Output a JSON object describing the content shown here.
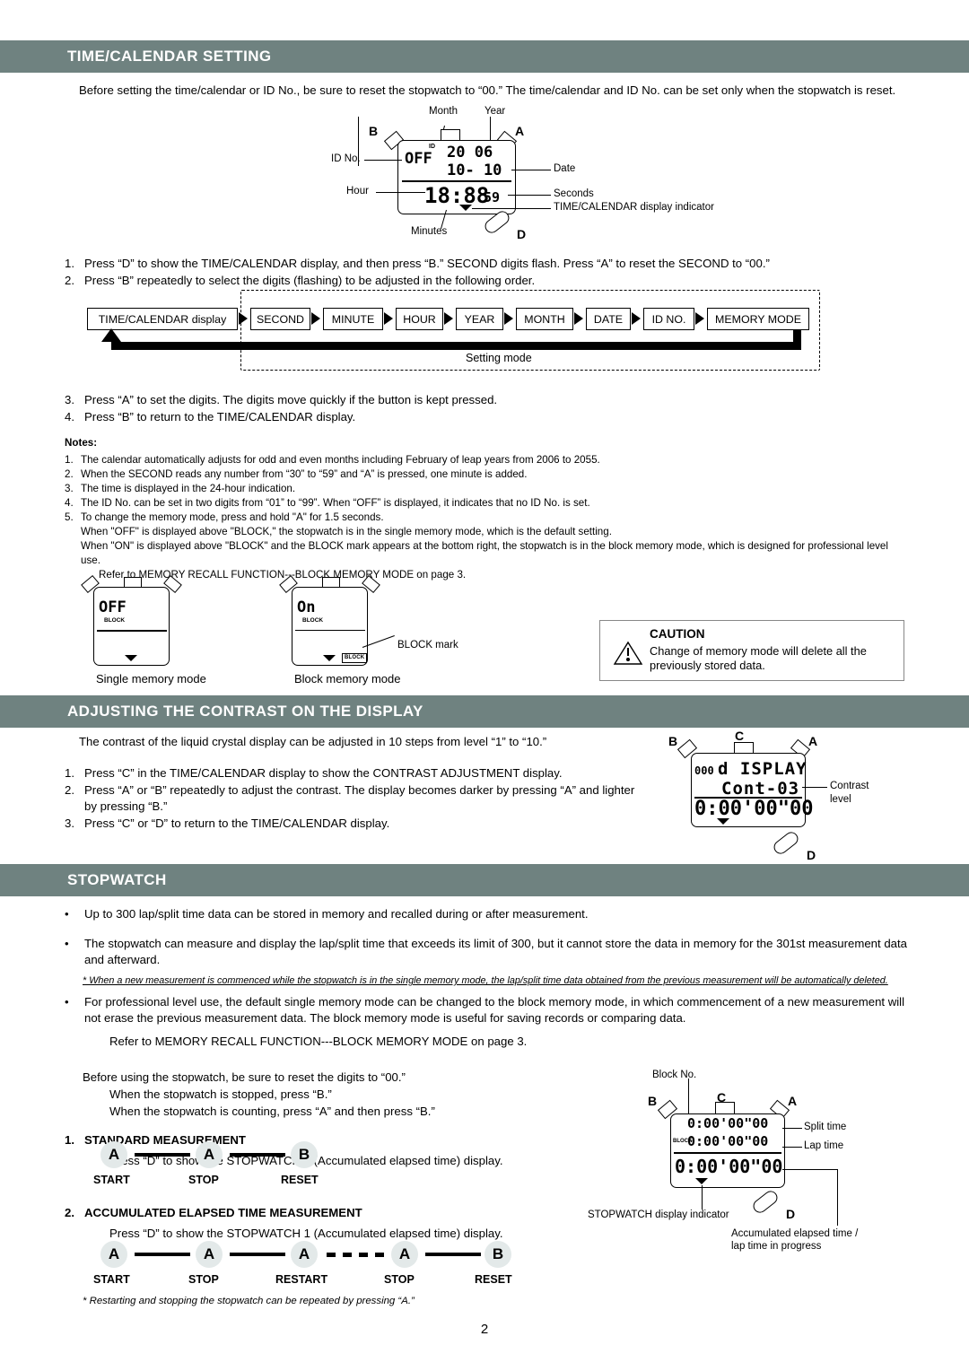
{
  "page": {
    "number": "2"
  },
  "sections": [
    {
      "id": "time-calendar",
      "title": "TIME/CALENDAR SETTING"
    },
    {
      "id": "contrast",
      "title": "ADJUSTING THE CONTRAST ON THE DISPLAY"
    },
    {
      "id": "stopwatch",
      "title": "STOPWATCH"
    }
  ],
  "time_calendar": {
    "intro": "Before setting the time/calendar or ID No., be sure to reset the stopwatch to “00.”  The time/calendar and ID No. can be set only when the stopwatch is reset.",
    "display": {
      "id_value": "OFF",
      "id_tag": "ID",
      "year": "20 06",
      "date_line": "10- 10",
      "time": "18:88",
      "seconds": "59",
      "button_b": "B",
      "button_a": "A",
      "button_d": "D",
      "labels": {
        "month": "Month",
        "year": "Year",
        "id_no": "ID No.",
        "date": "Date",
        "hour": "Hour",
        "seconds": "Seconds",
        "minutes": "Minutes",
        "indicator": "TIME/CALENDAR display indicator"
      }
    },
    "steps_top": [
      {
        "n": "1.",
        "text": "Press “D” to show the TIME/CALENDAR display, and then press “B.”  SECOND digits flash.  Press “A” to reset the SECOND to “00.”"
      },
      {
        "n": "2.",
        "text": "Press “B” repeatedly to select the digits (flashing) to be adjusted in the following order."
      }
    ],
    "flow": {
      "start_box": "TIME/CALENDAR display",
      "boxes": [
        "SECOND",
        "MINUTE",
        "HOUR",
        "YEAR",
        "MONTH",
        "DATE",
        "ID NO.",
        "MEMORY MODE"
      ],
      "caption": "Setting mode"
    },
    "steps_bottom": [
      {
        "n": "3.",
        "text": "Press “A” to set the digits.  The digits move quickly if the button is kept pressed."
      },
      {
        "n": "4.",
        "text": "Press “B” to return to the TIME/CALENDAR display."
      }
    ],
    "notes_title": "Notes:",
    "notes": [
      {
        "n": "1.",
        "text": "The calendar automatically adjusts for odd and even months including February of leap years from 2006 to 2055."
      },
      {
        "n": "2.",
        "text": "When the SECOND reads any number from “30” to “59” and “A” is pressed, one minute is added."
      },
      {
        "n": "3.",
        "text": "The time is displayed in the 24-hour indication."
      },
      {
        "n": "4.",
        "text": "The ID No. can be set in two digits from “01” to “99”.  When “OFF” is displayed, it indicates that no ID No. is set."
      },
      {
        "n": "5.",
        "text": "To change the memory mode, press and hold \"A\" for 1.5 seconds."
      }
    ],
    "notes_continued": [
      "When \"OFF\" is displayed above \"BLOCK,\" the stopwatch is in the single memory mode, which is the default setting.",
      "When \"ON\" is displayed above \"BLOCK\" and the BLOCK mark appears at the bottom right, the stopwatch is in the block memory mode, which is designed for professional level use."
    ],
    "notes_refer": "Refer to MEMORY RECALL FUNCTION---BLOCK MEMORY MODE on page 3.",
    "memory_modes": {
      "single": {
        "value": "OFF",
        "sub": "BLOCK",
        "caption": "Single memory mode"
      },
      "block": {
        "value": "On",
        "sub": "BLOCK",
        "caption": "Block memory mode",
        "mark": "BLOCK",
        "mark_label": "BLOCK mark"
      }
    },
    "caution": {
      "title": "CAUTION",
      "text": "Change of memory mode will delete all the previously stored data."
    }
  },
  "contrast": {
    "intro": "The contrast of the liquid crystal display can be adjusted in 10 steps from level “1” to “10.”",
    "steps": [
      {
        "n": "1.",
        "text": "Press “C” in the TIME/CALENDAR display to show the CONTRAST ADJUSTMENT display."
      },
      {
        "n": "2.",
        "text": "Press “A” or “B” repeatedly to adjust the contrast.  The display becomes darker by pressing “A” and lighter by pressing “B.”"
      },
      {
        "n": "3.",
        "text": "Press “C” or “D” to return to the TIME/CALENDAR display."
      }
    ],
    "display": {
      "left_digits": "000",
      "line1": "d ISPLAY",
      "line2": "Cont-03",
      "line3": "0:00'00\"00",
      "button_b": "B",
      "button_c": "C",
      "button_a": "A",
      "button_d": "D",
      "label_contrast_1": "Contrast",
      "label_contrast_2": "level"
    }
  },
  "stopwatch": {
    "bullets": [
      "Up to 300 lap/split time data can be stored in memory and recalled during or after measurement.",
      "The stopwatch can measure and display the lap/split time that exceeds its limit of 300, but it cannot store the data in memory for the 301st measurement data and afterward.",
      "For professional level use, the default single memory mode can be changed to the block memory mode, in which commencement of a new measurement will not erase the previous measurement data. The block memory mode is useful for saving records or comparing data."
    ],
    "footnote": "* When a new measurement is commenced while the stopwatch is in the single memory mode, the lap/split time data obtained from the previous measurement will be automatically deleted.",
    "refer": "Refer to MEMORY RECALL FUNCTION---BLOCK MEMORY MODE on page 3.",
    "before_use": [
      "Before using the stopwatch, be sure to reset the digits to “00.”",
      "When the stopwatch is stopped, press “B.”",
      "When the stopwatch is counting, press “A” and then press “B.”"
    ],
    "measurements": [
      {
        "n": "1.",
        "title": "STANDARD MEASUREMENT",
        "desc": "Press “D” to show the STOPWATCH 1 (Accumulated elapsed time) display.",
        "sequence": [
          {
            "button": "A",
            "label": "START",
            "connector": "solid"
          },
          {
            "button": "A",
            "label": "STOP",
            "connector": "solid"
          },
          {
            "button": "B",
            "label": "RESET",
            "connector": "none"
          }
        ]
      },
      {
        "n": "2.",
        "title": "ACCUMULATED ELAPSED TIME MEASUREMENT",
        "desc": "Press “D” to show the STOPWATCH 1 (Accumulated elapsed time) display.",
        "sequence": [
          {
            "button": "A",
            "label": "START",
            "connector": "solid"
          },
          {
            "button": "A",
            "label": "STOP",
            "connector": "solid"
          },
          {
            "button": "A",
            "label": "RESTART",
            "connector": "dashed"
          },
          {
            "button": "A",
            "label": "STOP",
            "connector": "solid"
          },
          {
            "button": "B",
            "label": "RESET",
            "connector": "none"
          }
        ],
        "footnote": "* Restarting and stopping the stopwatch can be repeated by pressing “A.”"
      }
    ],
    "display": {
      "split": "0:00'00\"00",
      "lap": "0:00'00\"00",
      "accum": "0:00'00\"00",
      "block_tag": "BLOCK",
      "button_b": "B",
      "button_c": "C",
      "button_a": "A",
      "button_d": "D",
      "labels": {
        "block_no": "Block No.",
        "split": "Split time",
        "lap": "Lap time",
        "indicator": "STOPWATCH display indicator",
        "accum_1": "Accumulated elapsed time /",
        "accum_2": "lap time in progress"
      }
    }
  },
  "colors": {
    "header_bar": "#6f8280",
    "header_text": "#ffffff",
    "button_circle": "#e3e9e9"
  }
}
